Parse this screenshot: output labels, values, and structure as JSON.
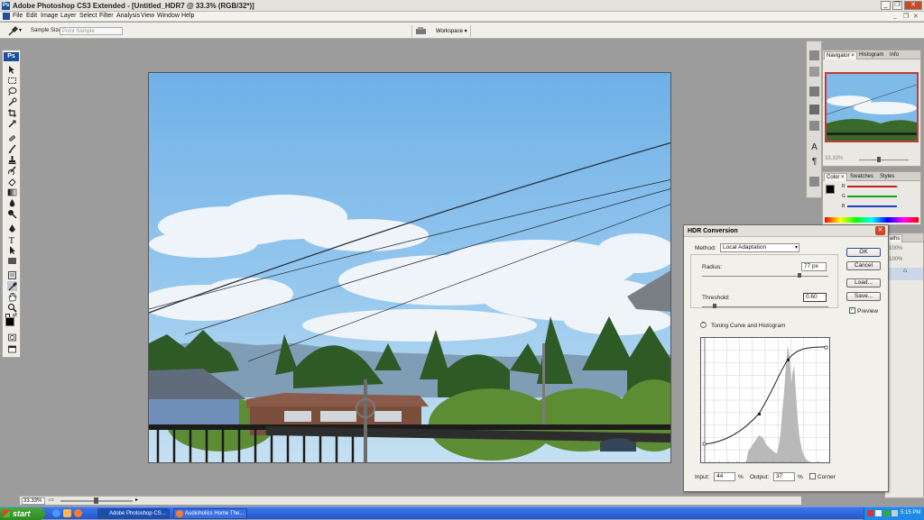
{
  "window": {
    "app_icon": "Ps",
    "title": "Adobe Photoshop CS3 Extended - [Untitled_HDR7 @ 33.3% (RGB/32*)]"
  },
  "menu": [
    "File",
    "Edit",
    "Image",
    "Layer",
    "Select",
    "Filter",
    "Analysis",
    "View",
    "Window",
    "Help"
  ],
  "options": {
    "sample_size_label": "Sample Size:",
    "sample_size_value": "Point Sample",
    "workspace_label": "Workspace ▾"
  },
  "toolbox": {
    "logo": "Ps"
  },
  "status": {
    "zoom": "33.33%"
  },
  "panels": {
    "navigator": {
      "tabs": [
        "Navigator ×",
        "Histogram",
        "Info"
      ],
      "zoom": "33.33%"
    },
    "color": {
      "tabs": [
        "Color ×",
        "Swatches",
        "Styles"
      ],
      "channels": [
        "R",
        "G",
        "B"
      ],
      "channel_colors": [
        "#c81a1a",
        "#1aa02a",
        "#1a3fc8"
      ]
    },
    "lower": {
      "tab_text": "aths",
      "percent_1": "100%",
      "percent_2": "100%"
    }
  },
  "dialog": {
    "title": "HDR Conversion",
    "method_label": "Method:",
    "method_value": "Local Adaptation",
    "radius_label": "Radius:",
    "radius_value": "77",
    "radius_unit": "px",
    "radius_level": 0.77,
    "threshold_label": "Threshold:",
    "threshold_value": "0.60",
    "threshold_level": 0.1,
    "toning_label": "Toning Curve and Histogram",
    "input_label": "Input:",
    "input_value": "44",
    "input_pct": "%",
    "output_label": "Output:",
    "output_value": "37",
    "output_pct": "%",
    "corner_label": "Corner",
    "preview_label": "Preview",
    "preview_checked": true,
    "buttons": {
      "ok": "OK",
      "cancel": "Cancel",
      "load": "Load...",
      "save": "Save..."
    }
  },
  "taskbar": {
    "start": "start",
    "tasks": [
      "Adobe Photoshop CS...",
      "Audioholics Home The..."
    ],
    "clock": "5:15 PM"
  }
}
